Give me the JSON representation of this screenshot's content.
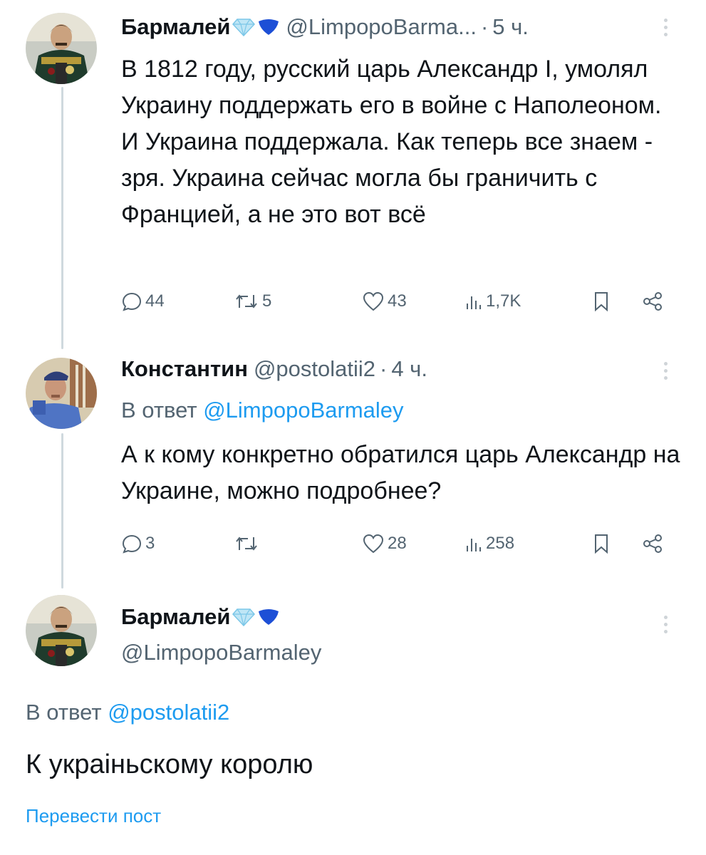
{
  "tweets": [
    {
      "name": "Бармалей",
      "handle": "@LimpopoBarma...",
      "dot": "·",
      "time": "5 ч.",
      "text": "В 1812 году, русский царь Александр I, умолял Украину поддержать его в войне с Наполеоном. И Украина поддержала. Как теперь все знаем - зря. Украина сейчас могла бы граничить с Францией, а не это вот всё",
      "replies": "44",
      "retweets": "5",
      "likes": "43",
      "views": "1,7K"
    },
    {
      "name": "Константин",
      "handle": "@postolatii2",
      "dot": "·",
      "time": "4 ч.",
      "reply_prefix": "В ответ",
      "reply_to": "@LimpopoBarmaley",
      "text": "А к кому конкретно обратился царь Александр на Украине, можно подробнее?",
      "replies": "3",
      "retweets": "",
      "likes": "28",
      "views": "258"
    },
    {
      "name": "Бармалей",
      "handle": "@LimpopoBarmaley",
      "reply_prefix": "В ответ",
      "reply_to": "@postolatii2",
      "text": "К украiньскому королю",
      "translate": "Перевести пост"
    }
  ],
  "colors": {
    "text": "#0f1419",
    "secondary": "#536471",
    "link": "#1d9bf0",
    "thread_line": "#cfd9de"
  }
}
